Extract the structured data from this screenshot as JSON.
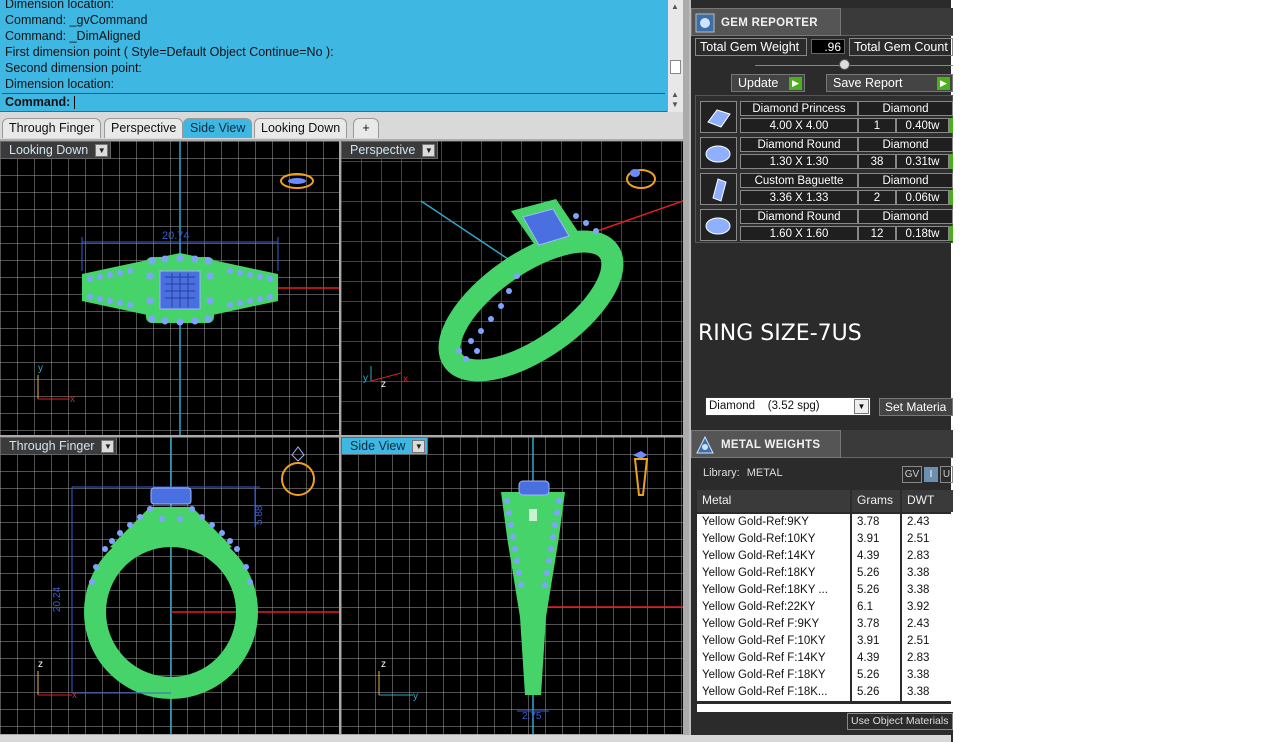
{
  "command_line": {
    "history": [
      "Dimension location:",
      "Command: _gvCommand",
      "Command: _DimAligned",
      "First dimension point ( Style=Default  Object  Continue=No ):",
      "Second dimension point:",
      "Dimension location:"
    ],
    "prompt_label": "Command:",
    "prompt_value": ""
  },
  "viewport_tabs": [
    {
      "label": "Through Finger",
      "active": false
    },
    {
      "label": "Perspective",
      "active": false
    },
    {
      "label": "Side View",
      "active": true
    },
    {
      "label": "Looking Down",
      "active": false
    },
    {
      "label": "+",
      "active": false
    }
  ],
  "viewports": {
    "top_left": {
      "label": "Looking Down",
      "dimension": "20.74",
      "axis_h": "x",
      "axis_v": "y"
    },
    "top_right": {
      "label": "Perspective",
      "axis_h": "x",
      "axis_v": "y",
      "axis_z": "z"
    },
    "bottom_left": {
      "label": "Through Finger",
      "dimension_v": "20.24",
      "dimension_s": "5.88",
      "axis_h": "x",
      "axis_v": "z"
    },
    "bottom_right": {
      "label": "Side View",
      "dimension": "2.75",
      "axis_h": "y",
      "axis_v": "z"
    }
  },
  "gem_reporter": {
    "title": "GEM REPORTER",
    "total_gem_weight_label": "Total Gem Weight",
    "total_gem_weight_value": ".96",
    "total_gem_count_label": "Total Gem Count",
    "update_label": "Update",
    "save_report_label": "Save Report",
    "gems": [
      {
        "name": "Diamond Princess",
        "material": "Diamond",
        "size": "4.00 X 4.00",
        "count": "1",
        "weight": "0.40tw",
        "shape": "princess"
      },
      {
        "name": "Diamond Round",
        "material": "Diamond",
        "size": "1.30 X 1.30",
        "count": "38",
        "weight": "0.31tw",
        "shape": "round"
      },
      {
        "name": "Custom Baguette",
        "material": "Diamond",
        "size": "3.36 X 1.33",
        "count": "2",
        "weight": "0.06tw",
        "shape": "baguette"
      },
      {
        "name": "Diamond Round",
        "material": "Diamond",
        "size": "1.60 X 1.60",
        "count": "12",
        "weight": "0.18tw",
        "shape": "round"
      }
    ],
    "annotation": "RING SIZE-7US",
    "material_select": "Diamond    (3.52 spg)",
    "set_material_label": "Set Materia"
  },
  "metal_weights": {
    "title": "METAL WEIGHTS",
    "library_label": "Library:",
    "library_value": "METAL",
    "unit_toggle": [
      "GV",
      "I",
      "U"
    ],
    "columns": [
      "Metal",
      "Grams",
      "DWT"
    ],
    "rows": [
      [
        "Yellow Gold-Ref:9KY",
        "3.78",
        "2.43"
      ],
      [
        "Yellow Gold-Ref:10KY",
        "3.91",
        "2.51"
      ],
      [
        "Yellow Gold-Ref:14KY",
        "4.39",
        "2.83"
      ],
      [
        "Yellow Gold-Ref:18KY",
        "5.26",
        "3.38"
      ],
      [
        "Yellow Gold-Ref:18KY ...",
        "5.26",
        "3.38"
      ],
      [
        "Yellow Gold-Ref:22KY",
        "6.1",
        "3.92"
      ],
      [
        "Yellow Gold-Ref F:9KY",
        "3.78",
        "2.43"
      ],
      [
        "Yellow Gold-Ref F:10KY",
        "3.91",
        "2.51"
      ],
      [
        "Yellow Gold-Ref F:14KY",
        "4.39",
        "2.83"
      ],
      [
        "Yellow Gold-Ref F:18KY",
        "5.26",
        "3.38"
      ],
      [
        "Yellow Gold-Ref F:18K...",
        "5.26",
        "3.38"
      ]
    ],
    "use_object_materials_label": "Use Object Materials"
  },
  "colors": {
    "command_bg": "#3fb7e3",
    "ring_green": "#46d46a",
    "gem_blue": "#7fa3ff",
    "axis_red": "#e02020",
    "axis_cyan": "#2fa9c9",
    "accent_green": "#4caf1c"
  }
}
